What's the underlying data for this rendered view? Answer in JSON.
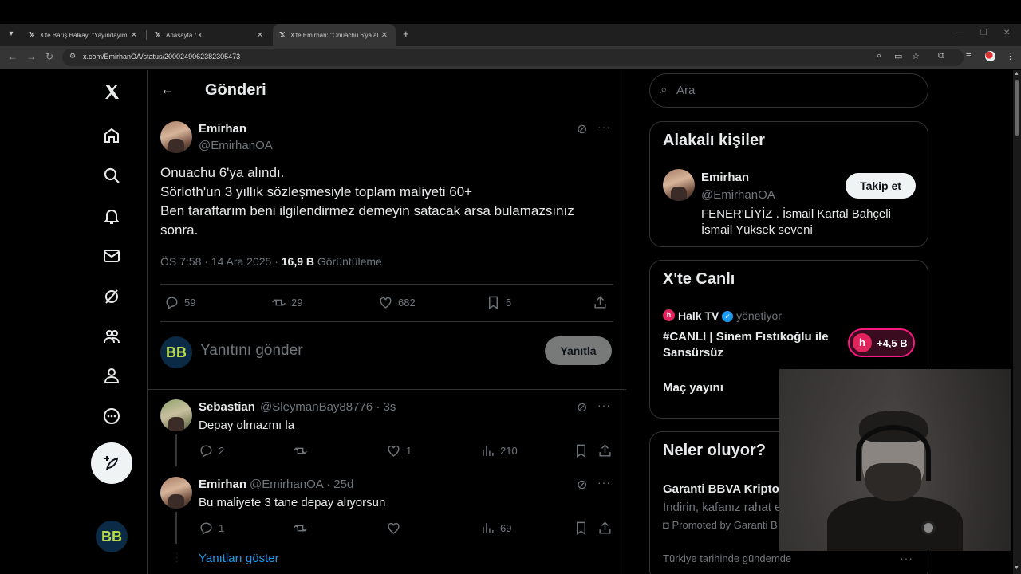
{
  "browser": {
    "tabs": [
      {
        "title": "X'te Barış Balkay: \"Yayındayım. l",
        "active": false
      },
      {
        "title": "Anasayfa / X",
        "active": false
      },
      {
        "title": "X'te Emirhan: \"Onuachu 6'ya al",
        "active": true
      }
    ],
    "url": "x.com/EmirhanOA/status/2000249062382305473"
  },
  "header": {
    "title": "Gönderi"
  },
  "tweet": {
    "author_name": "Emirhan",
    "author_handle": "@EmirhanOA",
    "text": "Onuachu 6'ya alındı.\nSörloth'un 3 yıllık sözleşmesiyle toplam maliyeti 60+\nBen taraftarım beni ilgilendirmez demeyin satacak arsa bulamazsınız sonra.",
    "time": "ÖS 7:58 · 14 Ara 2025 · ",
    "views": "16,9 B",
    "views_label": " Görüntüleme",
    "replies": "59",
    "retweets": "29",
    "likes": "682",
    "bookmarks": "5"
  },
  "composer": {
    "placeholder": "Yanıtını gönder",
    "button": "Yanıtla",
    "avatar_text": "BB"
  },
  "comments": [
    {
      "name": "Sebastian",
      "handle": "@SleymanBay88776 · 3s",
      "text": "Depay olmazmı la",
      "replies": "2",
      "retweets": "",
      "likes": "1",
      "views": "210"
    },
    {
      "name": "Emirhan",
      "handle": "@EmirhanOA · 25d",
      "text": "Bu maliyete 3 tane depay alıyorsun",
      "replies": "1",
      "retweets": "",
      "likes": "",
      "views": "69"
    }
  ],
  "show_replies": "Yanıtları göster",
  "search": {
    "placeholder": "Ara"
  },
  "related": {
    "title": "Alakalı kişiler",
    "name": "Emirhan",
    "handle": "@EmirhanOA",
    "follow": "Takip et",
    "bio": "FENER'LİYİZ . İsmail Kartal Bahçeli İsmail Yüksek seveni"
  },
  "live": {
    "title": "X'te Canlı",
    "host": "Halk TV",
    "host_role": "yönetiyor",
    "stream_title": "#CANLI | Sinem Fıstıkoğlu ile Sansürsüz",
    "listeners": "+4,5 B",
    "second": "Maç yayını"
  },
  "trends": {
    "title": "Neler oluyor?",
    "item_title": "Garanti BBVA Kripto",
    "item_sub": "İndirin, kafanız rahat e",
    "promoted": "Promoted by Garanti B",
    "next_label": "Türkiye tarihinde gündemde"
  },
  "colors": {
    "accent": "#1d9bf0",
    "live": "#f91880",
    "background": "#000000",
    "border": "#2f3336"
  }
}
